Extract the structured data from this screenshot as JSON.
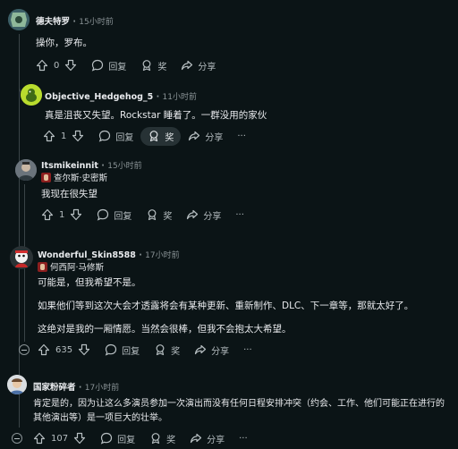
{
  "labels": {
    "reply": "回复",
    "award": "奖",
    "share": "分享",
    "more": "···",
    "dot": "·"
  },
  "comments": [
    {
      "username": "德夫特罗",
      "time": "15小时前",
      "lines": [
        "操你，罗布。"
      ],
      "score": "0"
    },
    {
      "username": "Objective_Hedgehog_5",
      "time": "11小时前",
      "lines": [
        "真是沮丧又失望。Rockstar 睡着了。一群没用的家伙"
      ],
      "score": "1"
    },
    {
      "username": "Itsmikeinnit",
      "time": "15小时前",
      "flair": "查尔斯·史密斯",
      "lines": [
        "我现在很失望"
      ],
      "score": "1"
    },
    {
      "username": "Wonderful_Skin8588",
      "time": "17小时前",
      "flair": "何西阿·马修斯",
      "lines": [
        "可能是，但我希望不是。",
        "如果他们等到这次大会才透露将会有某种更新、重新制作、DLC、下一章等，那就太好了。",
        "这绝对是我的一厢情愿。当然会很棒，但我不会抱太大希望。"
      ],
      "score": "635"
    },
    {
      "username": "国家粉碎者",
      "time": "17小时前",
      "lines": [
        "肯定是的，因为让这么多演员参加一次演出而没有任何日程安排冲突（约会、工作、他们可能正在进行的",
        "其他演出等）是一项巨大的壮举。"
      ],
      "score": "107"
    }
  ]
}
